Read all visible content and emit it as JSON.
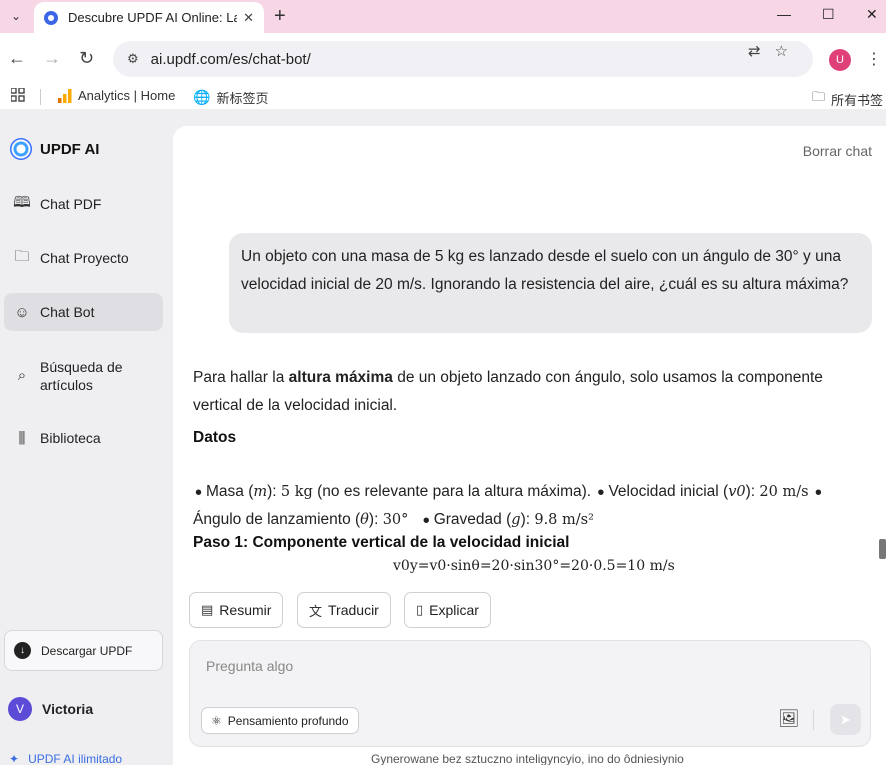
{
  "browser": {
    "tab_title": "Descubre UPDF AI Online: La",
    "url": "ai.updf.com/es/chat-bot/",
    "profile_initial": "U",
    "bookmarks": [
      {
        "label": "Analytics | Home"
      },
      {
        "label": "新标签页"
      }
    ],
    "all_bookmarks_label": "所有书签"
  },
  "sidebar": {
    "brand": "UPDF AI",
    "items": [
      {
        "label": "Chat PDF",
        "icon": "book-open-icon"
      },
      {
        "label": "Chat Proyecto",
        "icon": "folder-icon"
      },
      {
        "label": "Chat Bot",
        "icon": "bot-icon",
        "active": true
      },
      {
        "label": "Búsqueda de artículos",
        "icon": "search-doc-icon"
      },
      {
        "label": "Biblioteca",
        "icon": "library-icon"
      }
    ],
    "download_label": "Descargar UPDF",
    "user_initial": "V",
    "user_name": "Victoria",
    "unlimited_label": "UPDF AI ilimitado"
  },
  "chat": {
    "clear_label": "Borrar chat",
    "user_message": "Un objeto con una masa de 5 kg es lanzado desde el suelo con un ángulo de 30° y una velocidad inicial de 20 m/s. Ignorando la resistencia del aire, ¿cuál es su altura máxima?",
    "answer_intro_pre": "Para hallar la ",
    "answer_intro_bold": "altura máxima",
    "answer_intro_post": " de un objeto lanzado con ángulo, solo usamos la componente vertical de la velocidad inicial.",
    "datos_heading": "Datos",
    "datos_items": [
      {
        "label": "Masa (",
        "var": "m",
        "mid": "): ",
        "value": "5 kg",
        "suffix": " (no es relevante para la altura máxima)."
      },
      {
        "label": "Velocidad inicial (",
        "var": "v0",
        "mid": "): ",
        "value": "20 m/s",
        "suffix": ""
      },
      {
        "label": "Ángulo de lanzamiento (",
        "var": "θ",
        "mid": "): ",
        "value": "30°",
        "suffix": ""
      },
      {
        "label": "Gravedad (",
        "var": "g",
        "mid": "): ",
        "value": "9.8 m/s²",
        "suffix": ""
      }
    ],
    "step1_heading": "Paso 1: Componente vertical de la velocidad inicial",
    "step1_formula": "v0y=v0·sinθ=20·sin30°=20·0.5=10 m/s"
  },
  "actions": [
    {
      "label": "Resumir",
      "icon": "summary-icon"
    },
    {
      "label": "Traducir",
      "icon": "translate-icon"
    },
    {
      "label": "Explicar",
      "icon": "book-icon"
    }
  ],
  "composer": {
    "placeholder": "Pregunta algo",
    "value": "",
    "deep_label": "Pensamiento profundo"
  },
  "footer_note": "Gynerowane bez sztuczno inteligyncyio, ino do ôdniesiynio"
}
